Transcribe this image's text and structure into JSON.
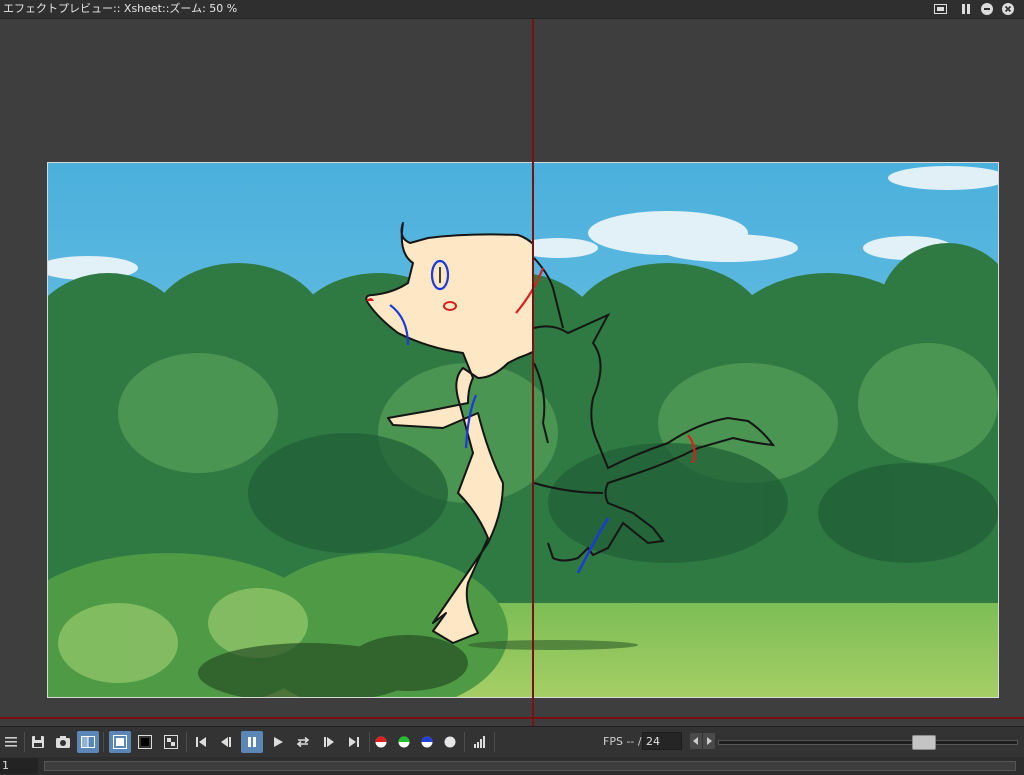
{
  "window": {
    "title": "エフェクトプレビュー:: Xsheet::ズーム: 50 %",
    "controls": [
      "fullscreen-icon",
      "pause-icon",
      "minimize-icon",
      "close-icon"
    ]
  },
  "toolbar": {
    "buttons": [
      {
        "icon": "menu-icon"
      },
      {
        "icon": "save-icon"
      },
      {
        "icon": "camera-icon"
      },
      {
        "icon": "compare-icon",
        "active": true
      },
      {
        "icon": "white-bg-icon",
        "active": true
      },
      {
        "icon": "black-bg-icon"
      },
      {
        "icon": "checker-bg-icon"
      },
      {
        "icon": "first-frame-icon"
      },
      {
        "icon": "prev-frame-icon"
      },
      {
        "icon": "pause-icon",
        "active": true
      },
      {
        "icon": "play-icon"
      },
      {
        "icon": "loop-icon"
      },
      {
        "icon": "next-frame-icon"
      },
      {
        "icon": "last-frame-icon"
      },
      {
        "icon": "red-channel-icon"
      },
      {
        "icon": "green-channel-icon"
      },
      {
        "icon": "blue-channel-icon"
      },
      {
        "icon": "alpha-channel-icon"
      },
      {
        "icon": "histogram-icon"
      }
    ],
    "fps_label": "FPS -- /",
    "fps_value": "24"
  },
  "frame": {
    "current": "1"
  },
  "colors": {
    "accent": "#5b87b6",
    "guide_line": "#7a1010",
    "sky": "#5ab6dc",
    "foliage": "#3f8a4a",
    "character_fill": "#fde7c4"
  }
}
